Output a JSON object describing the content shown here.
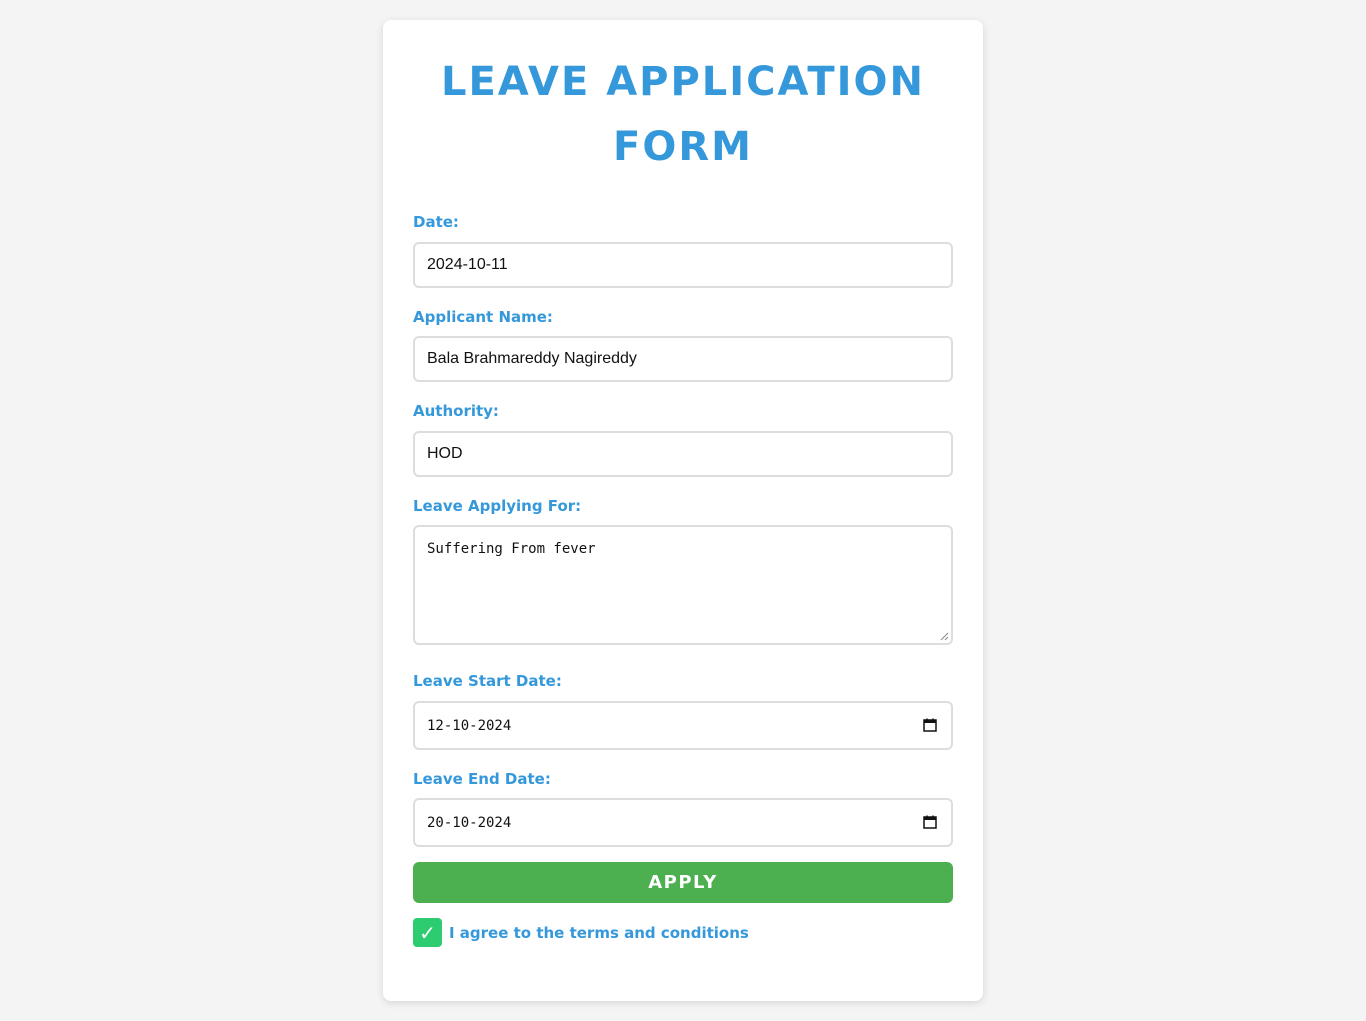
{
  "form": {
    "title_line1": "LEAVE APPLICATION",
    "title_line2": "FORM",
    "date_label": "Date:",
    "date_value": "2024-10-11",
    "applicant_label": "Applicant Name:",
    "applicant_value": "Bala Brahmareddy Nagireddy",
    "authority_label": "Authority:",
    "authority_value": "HOD",
    "reason_label": "Leave Applying For:",
    "reason_value": "Suffering From fever",
    "start_label": "Leave Start Date:",
    "start_value": "12-10-2024",
    "end_label": "Leave End Date:",
    "end_value": "20-10-2024",
    "apply_label": "APPLY",
    "agree_checked": true,
    "agree_mark": "✓",
    "agree_label": "I agree to the terms and conditions"
  },
  "colors": {
    "page_background": "#f4f4f4",
    "accent_blue": "#3498db",
    "apply_green": "#4caf50",
    "checkbox_green": "#2ecc71"
  },
  "icons": {
    "date_picker": "calendar-icon",
    "textarea_resize": "resize-grip-icon",
    "checkbox": "check-icon"
  }
}
